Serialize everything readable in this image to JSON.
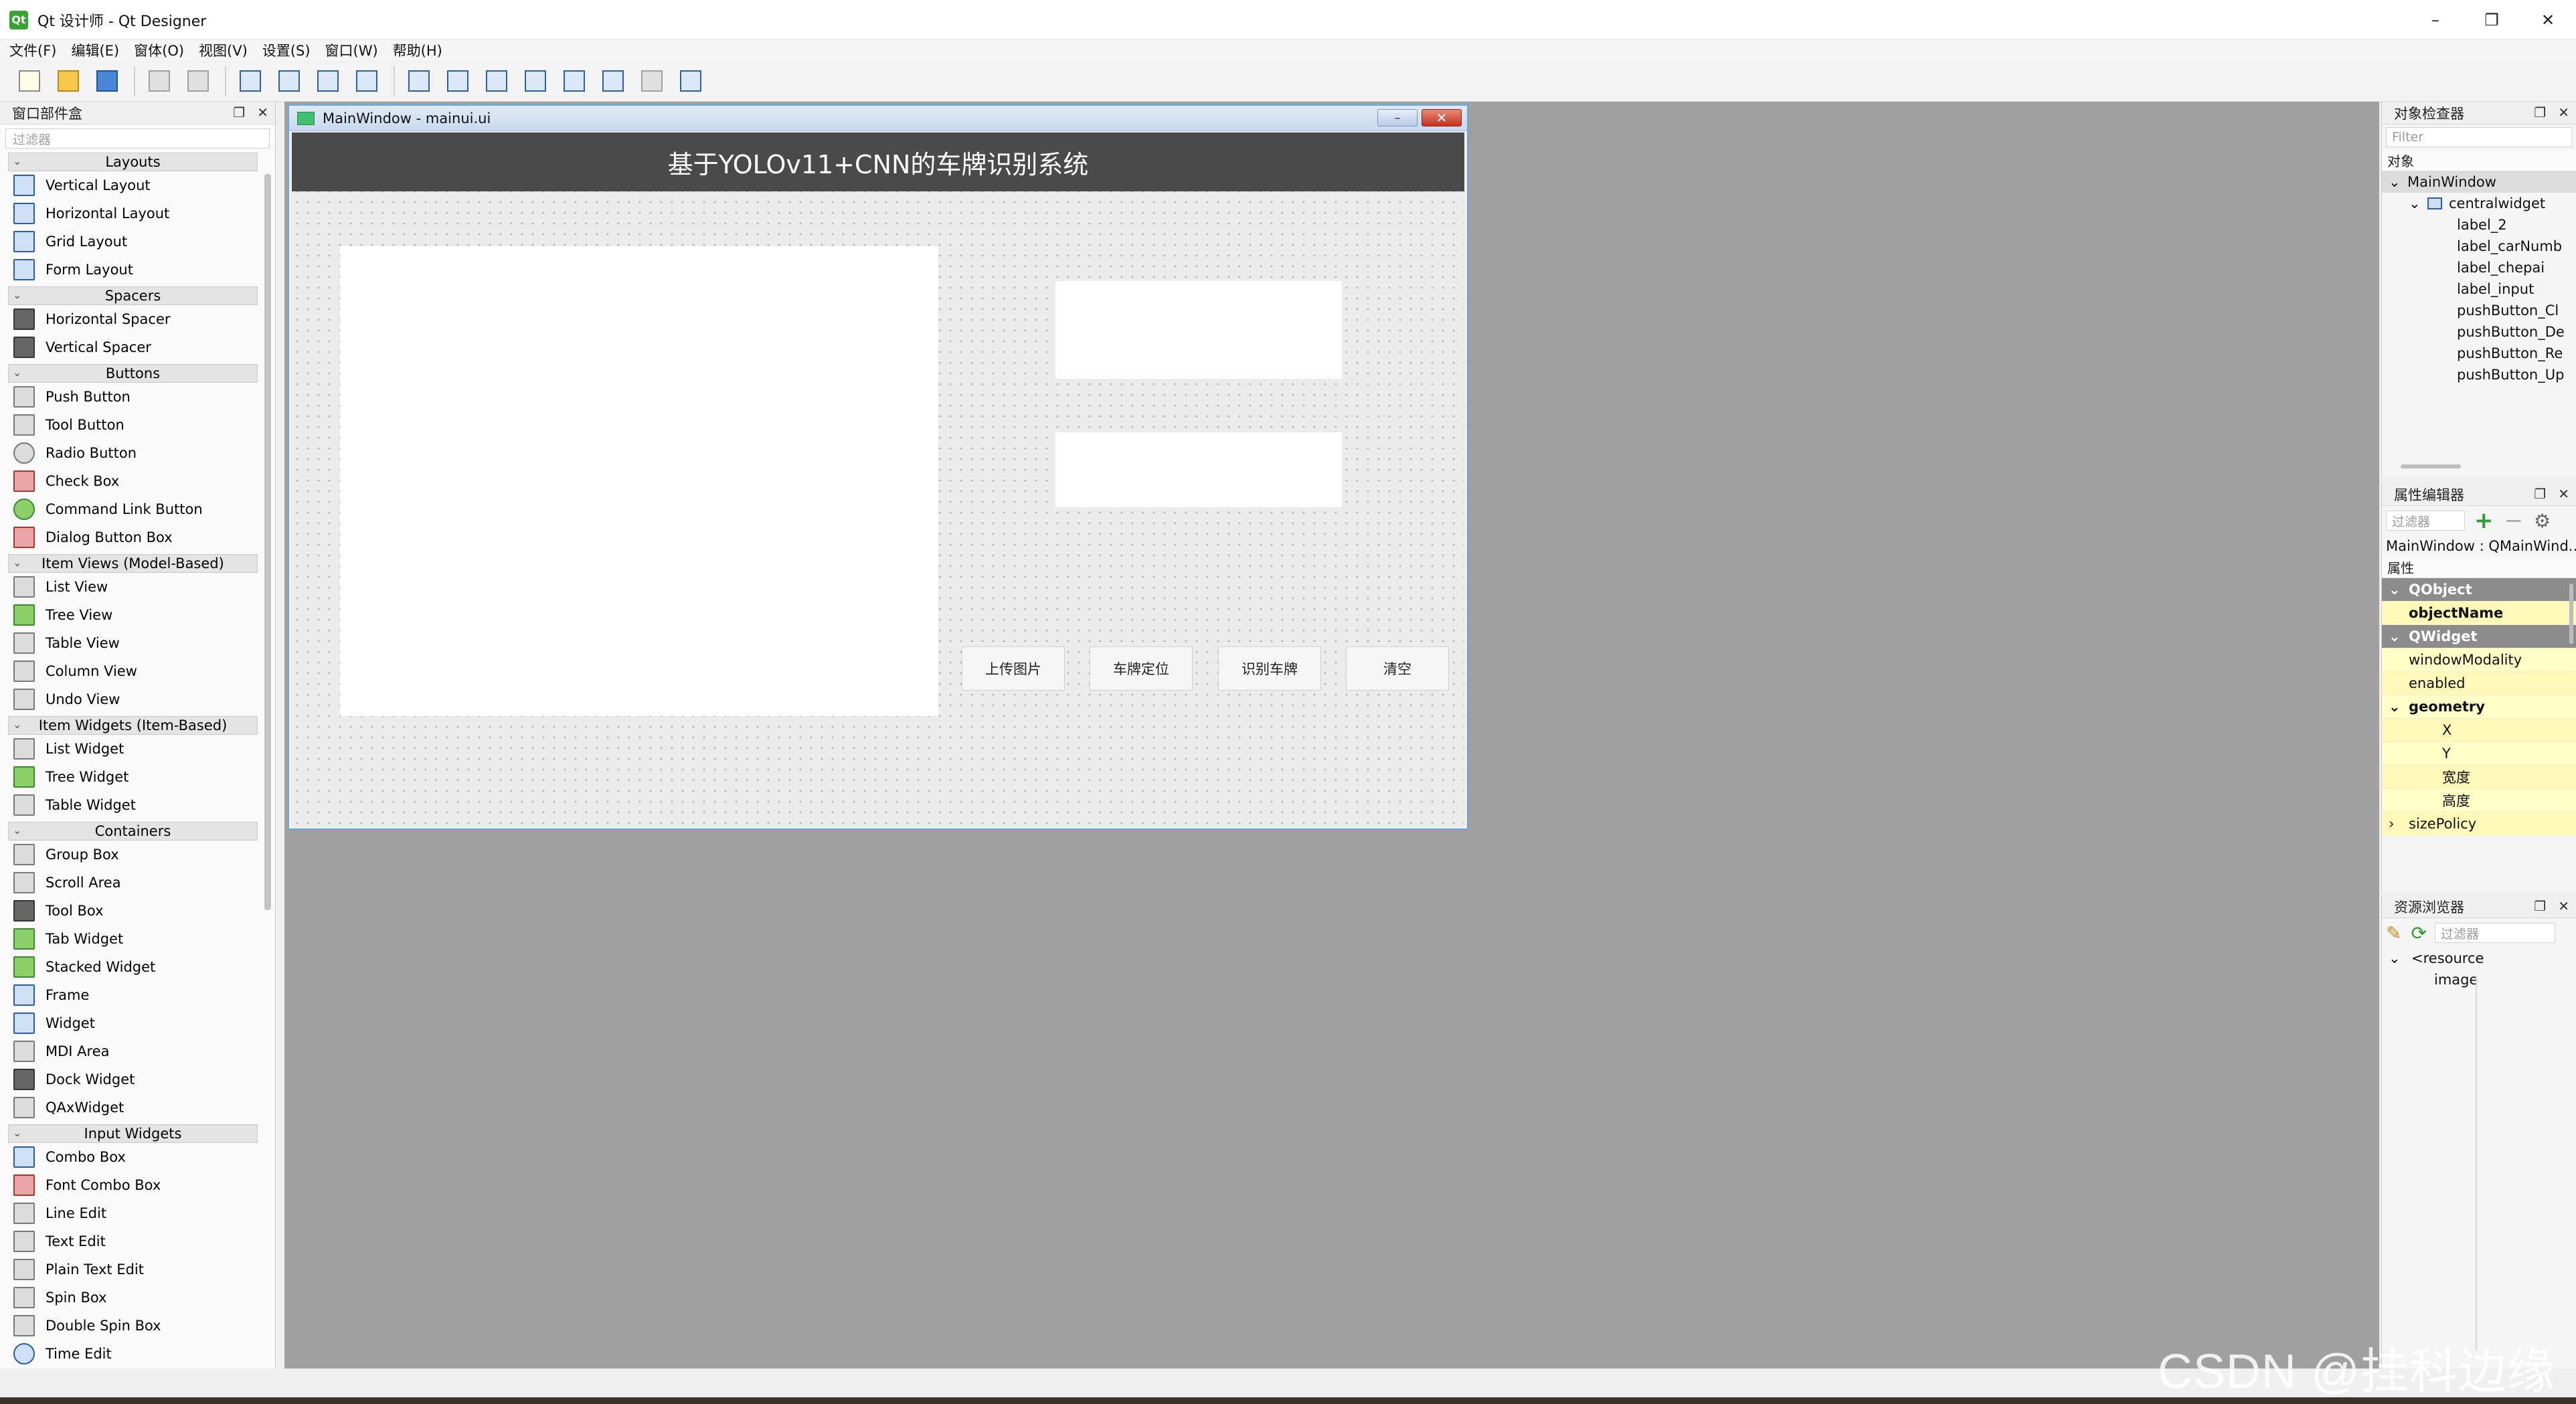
{
  "app": {
    "title": "Qt 设计师 - Qt Designer",
    "icon_label": "Qt",
    "minimize": "–",
    "maximize": "❐",
    "close": "✕"
  },
  "menu": [
    "文件(F)",
    "编辑(E)",
    "窗体(O)",
    "视图(V)",
    "设置(S)",
    "窗口(W)",
    "帮助(H)"
  ],
  "toolbar": {
    "icons": [
      "new-file-icon",
      "open-file-icon",
      "save-icon",
      "copy-icon",
      "paste-icon",
      "edit-widgets-icon",
      "edit-signals-icon",
      "edit-buddies-icon",
      "edit-tab-order-icon",
      "layout-horizontal-icon",
      "layout-vertical-icon",
      "layout-h-splitter-icon",
      "layout-v-splitter-icon",
      "layout-grid-icon",
      "layout-form-icon",
      "break-layout-icon",
      "adjust-size-icon"
    ]
  },
  "widgetbox": {
    "title": "窗口部件盒",
    "filter_placeholder": "过滤器",
    "categories": [
      {
        "name": "Layouts",
        "items": [
          "Vertical Layout",
          "Horizontal Layout",
          "Grid Layout",
          "Form Layout"
        ]
      },
      {
        "name": "Spacers",
        "items": [
          "Horizontal Spacer",
          "Vertical Spacer"
        ]
      },
      {
        "name": "Buttons",
        "items": [
          "Push Button",
          "Tool Button",
          "Radio Button",
          "Check Box",
          "Command Link Button",
          "Dialog Button Box"
        ]
      },
      {
        "name": "Item Views (Model-Based)",
        "items": [
          "List View",
          "Tree View",
          "Table View",
          "Column View",
          "Undo View"
        ]
      },
      {
        "name": "Item Widgets (Item-Based)",
        "items": [
          "List Widget",
          "Tree Widget",
          "Table Widget"
        ]
      },
      {
        "name": "Containers",
        "items": [
          "Group Box",
          "Scroll Area",
          "Tool Box",
          "Tab Widget",
          "Stacked Widget",
          "Frame",
          "Widget",
          "MDI Area",
          "Dock Widget",
          "QAxWidget"
        ]
      },
      {
        "name": "Input Widgets",
        "items": [
          "Combo Box",
          "Font Combo Box",
          "Line Edit",
          "Text Edit",
          "Plain Text Edit",
          "Spin Box",
          "Double Spin Box",
          "Time Edit"
        ]
      }
    ]
  },
  "form": {
    "window_title": "MainWindow - mainui.ui",
    "header": "基于YOLOv11+CNN的车牌识别系统",
    "buttons": [
      "上传图片",
      "车牌定位",
      "识别车牌",
      "清空"
    ]
  },
  "object_inspector": {
    "title": "对象检查器",
    "filter_placeholder": "Filter",
    "column": "对象",
    "tree": [
      {
        "label": "MainWindow",
        "level": 0,
        "selected": true
      },
      {
        "label": "centralwidget",
        "level": 1
      },
      {
        "label": "label_2",
        "level": 2
      },
      {
        "label": "label_carNumb",
        "level": 2
      },
      {
        "label": "label_chepai",
        "level": 2
      },
      {
        "label": "label_input",
        "level": 2
      },
      {
        "label": "pushButton_Cl",
        "level": 2
      },
      {
        "label": "pushButton_De",
        "level": 2
      },
      {
        "label": "pushButton_Re",
        "level": 2
      },
      {
        "label": "pushButton_Up",
        "level": 2
      }
    ]
  },
  "property_editor": {
    "title": "属性编辑器",
    "filter_placeholder": "过滤器",
    "object_label": "MainWindow : QMainWind...",
    "column": "属性",
    "rows": [
      {
        "label": "QObject",
        "kind": "group"
      },
      {
        "label": "objectName",
        "kind": "bold"
      },
      {
        "label": "QWidget",
        "kind": "group"
      },
      {
        "label": "windowModality",
        "kind": "normal"
      },
      {
        "label": "enabled",
        "kind": "normal"
      },
      {
        "label": "geometry",
        "kind": "expanded"
      },
      {
        "label": "X",
        "kind": "sub"
      },
      {
        "label": "Y",
        "kind": "sub"
      },
      {
        "label": "宽度",
        "kind": "sub"
      },
      {
        "label": "高度",
        "kind": "sub"
      },
      {
        "label": "sizePolicy",
        "kind": "collapsed"
      }
    ]
  },
  "resource_browser": {
    "title": "资源浏览器",
    "filter_placeholder": "过滤器",
    "tree": [
      "<resource",
      "image"
    ]
  },
  "watermark": "CSDN @挂科边缘"
}
